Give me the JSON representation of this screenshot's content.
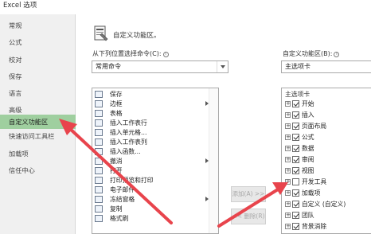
{
  "window": {
    "title": "Excel 选项"
  },
  "sidebar": {
    "items": [
      {
        "label": "常规",
        "selected": false
      },
      {
        "label": "公式",
        "selected": false
      },
      {
        "label": "校对",
        "selected": false
      },
      {
        "label": "保存",
        "selected": false
      },
      {
        "label": "语言",
        "selected": false
      },
      {
        "label": "高级",
        "selected": false
      },
      {
        "label": "自定义功能区",
        "selected": true
      },
      {
        "label": "快速访问工具栏",
        "selected": false
      },
      {
        "label": "加载项",
        "selected": false
      },
      {
        "label": "信任中心",
        "selected": false
      }
    ]
  },
  "header": {
    "title": "自定义功能区。"
  },
  "left_panel": {
    "label": "从下列位置选择命令(C):",
    "dropdown_value": "常用命令",
    "commands": [
      {
        "label": "保存",
        "submenu": false
      },
      {
        "label": "边框",
        "submenu": true
      },
      {
        "label": "表格",
        "submenu": false
      },
      {
        "label": "插入工作表行",
        "submenu": false
      },
      {
        "label": "插入单元格...",
        "submenu": false
      },
      {
        "label": "插入工作表列",
        "submenu": false
      },
      {
        "label": "插入函数...",
        "submenu": false
      },
      {
        "label": "撤消",
        "submenu": true
      },
      {
        "label": "打开",
        "submenu": false
      },
      {
        "label": "打印预览和打印",
        "submenu": false
      },
      {
        "label": "电子邮件",
        "submenu": false
      },
      {
        "label": "冻结窗格",
        "submenu": true
      },
      {
        "label": "复制",
        "submenu": false
      },
      {
        "label": "格式刷",
        "submenu": false
      }
    ]
  },
  "middle_buttons": {
    "add_label": "添加(A) >>",
    "remove_label": "<< 删除(R)"
  },
  "right_panel": {
    "label": "自定义功能区(B):",
    "dropdown_value": "主选项卡",
    "tree_header": "主选项卡",
    "tabs": [
      {
        "label": "开始",
        "checked": true
      },
      {
        "label": "插入",
        "checked": true
      },
      {
        "label": "页面布局",
        "checked": true
      },
      {
        "label": "公式",
        "checked": true
      },
      {
        "label": "数据",
        "checked": true
      },
      {
        "label": "审阅",
        "checked": true
      },
      {
        "label": "视图",
        "checked": true
      },
      {
        "label": "开发工具",
        "checked": false
      },
      {
        "label": "加载项",
        "checked": true
      },
      {
        "label": "自定义 (自定义)",
        "checked": true
      },
      {
        "label": "团队",
        "checked": true
      },
      {
        "label": "背景消除",
        "checked": true
      }
    ]
  },
  "annotations": {
    "arrow_color": "#e8444c"
  },
  "colors": {
    "selected_item": "#9fcf9f",
    "sidebar_bg": "#f0f0f0"
  }
}
